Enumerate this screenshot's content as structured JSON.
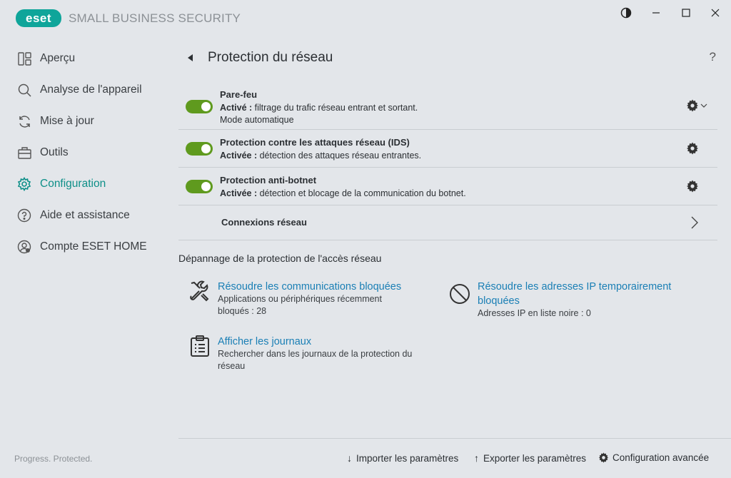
{
  "app": {
    "logo_text": "eset",
    "product_name": "SMALL BUSINESS SECURITY"
  },
  "window_controls": {
    "theme": "theme-toggle-icon",
    "minimize": "minimize-icon",
    "maximize": "maximize-icon",
    "close": "close-icon"
  },
  "sidebar": {
    "items": [
      {
        "label": "Aperçu",
        "icon": "overview-icon"
      },
      {
        "label": "Analyse de l'appareil",
        "icon": "search-icon"
      },
      {
        "label": "Mise à jour",
        "icon": "refresh-icon"
      },
      {
        "label": "Outils",
        "icon": "briefcase-icon"
      },
      {
        "label": "Configuration",
        "icon": "gear-icon",
        "active": true
      },
      {
        "label": "Aide et assistance",
        "icon": "help-icon"
      },
      {
        "label": "Compte ESET HOME",
        "icon": "account-icon"
      }
    ],
    "footer": "Progress. Protected."
  },
  "header": {
    "title": "Protection du réseau",
    "help": "?"
  },
  "protection_rows": [
    {
      "title": "Pare-feu",
      "status_label": "Activé :",
      "status_text": " filtrage du trafic réseau entrant et sortant.",
      "extra": "Mode automatique",
      "enabled": true
    },
    {
      "title": "Protection contre les attaques réseau (IDS)",
      "status_label": "Activée :",
      "status_text": " détection des attaques réseau entrantes.",
      "enabled": true
    },
    {
      "title": "Protection anti-botnet",
      "status_label": "Activée :",
      "status_text": " détection et blocage de la communication du botnet.",
      "enabled": true
    }
  ],
  "network_connections": {
    "label": "Connexions réseau"
  },
  "troubleshooting": {
    "title": "Dépannage de la protection de l'accès réseau",
    "tiles": [
      {
        "title": "Résoudre les communications bloquées",
        "desc_line1": "Applications ou périphériques récemment",
        "desc_line2": "bloqués : 28",
        "icon": "tools-icon"
      },
      {
        "title_line1": "Résoudre les adresses IP temporairement",
        "title_line2": "bloquées",
        "desc_line1": "Adresses IP en liste noire : 0",
        "icon": "blocked-icon"
      },
      {
        "title": "Afficher les journaux",
        "desc_line1": "Rechercher dans les journaux de la protection du",
        "desc_line2": "réseau",
        "icon": "clipboard-icon"
      }
    ]
  },
  "footer_actions": {
    "import": "Importer les paramètres",
    "export": "Exporter les paramètres",
    "advanced": "Configuration avancée"
  },
  "colors": {
    "accent": "#0d8f88",
    "toggle_on": "#5f9a1e",
    "link": "#1a7fb5",
    "background": "#e3e6ea"
  }
}
